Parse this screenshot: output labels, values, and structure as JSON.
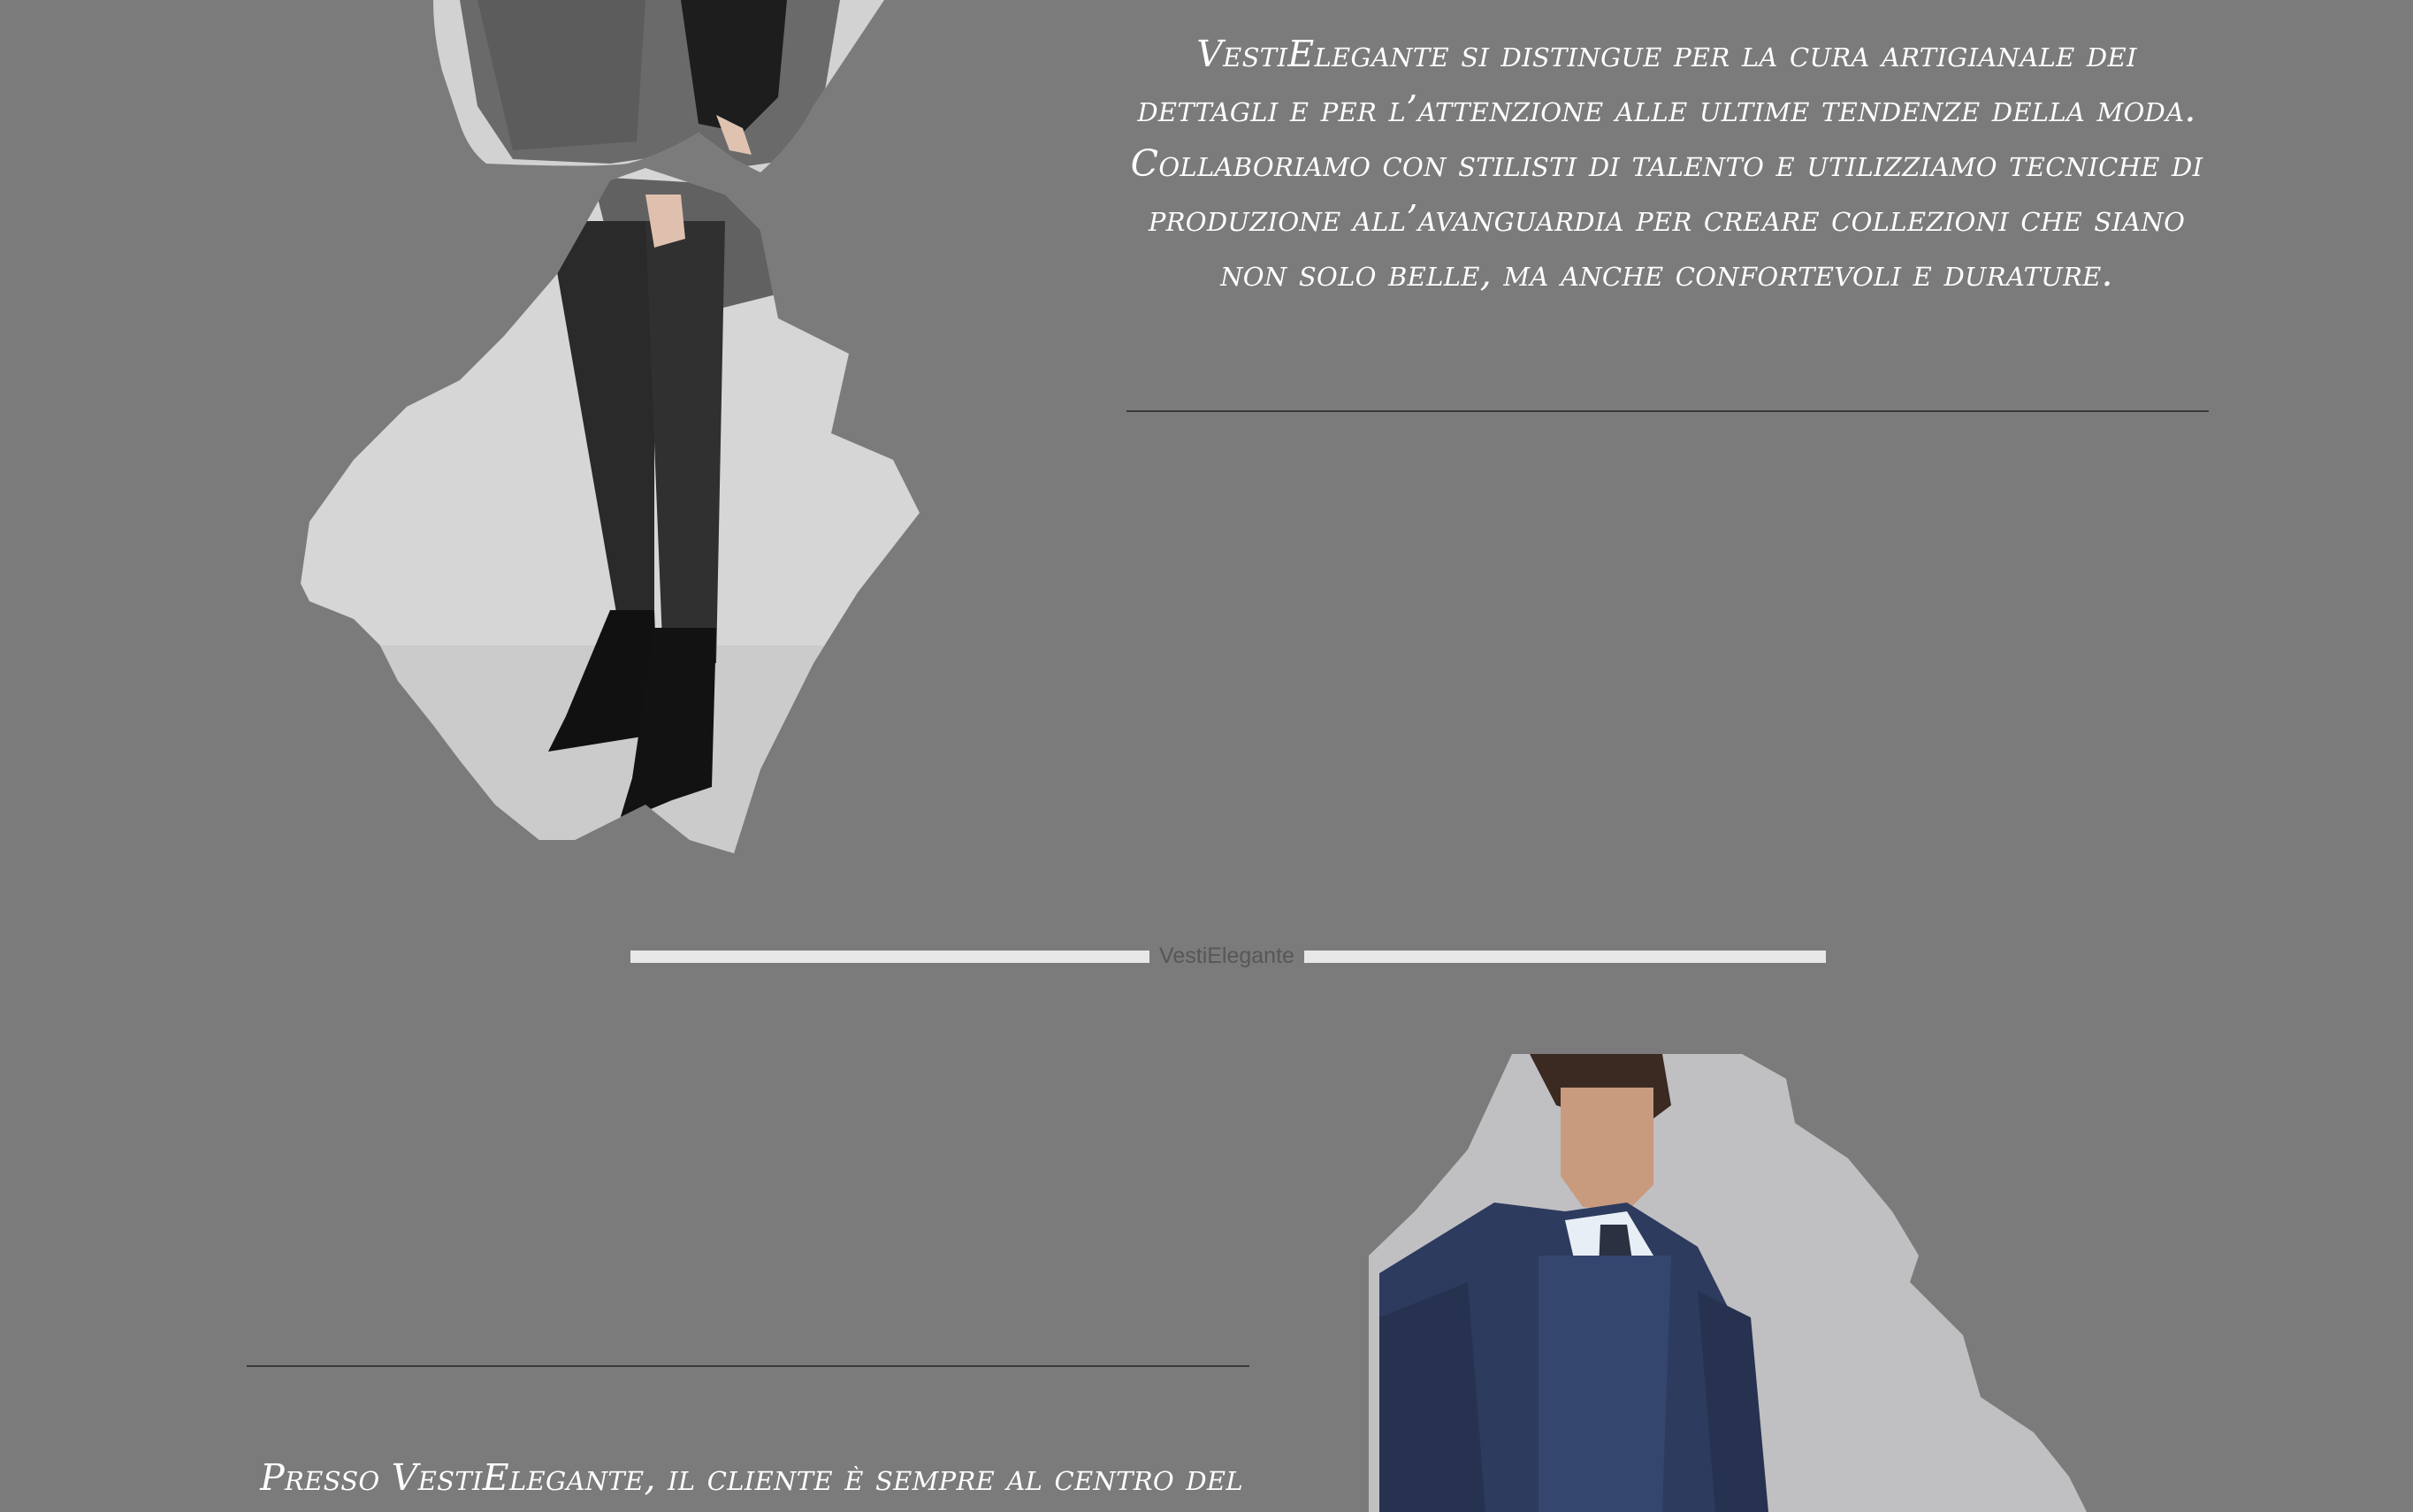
{
  "about": {
    "text": "VestiElegante si distingue per la cura artigianale dei dettagli e per l’attenzione alle ultime tendenze della moda. Collaboriamo con stilisti di talento e utilizziamo tecniche di produzione all’avanguardia per creare collezioni che siano non solo belle, ma anche confortevoli e durature."
  },
  "divider": {
    "label": "VestiElegante"
  },
  "customer": {
    "text": "Presso VestiElegante, il cliente è sempre al centro del"
  },
  "colors": {
    "background": "#7b7b7b",
    "text": "#ffffff",
    "divider_bar": "#e7e7e7",
    "rule_line": "#3a3a3a"
  }
}
